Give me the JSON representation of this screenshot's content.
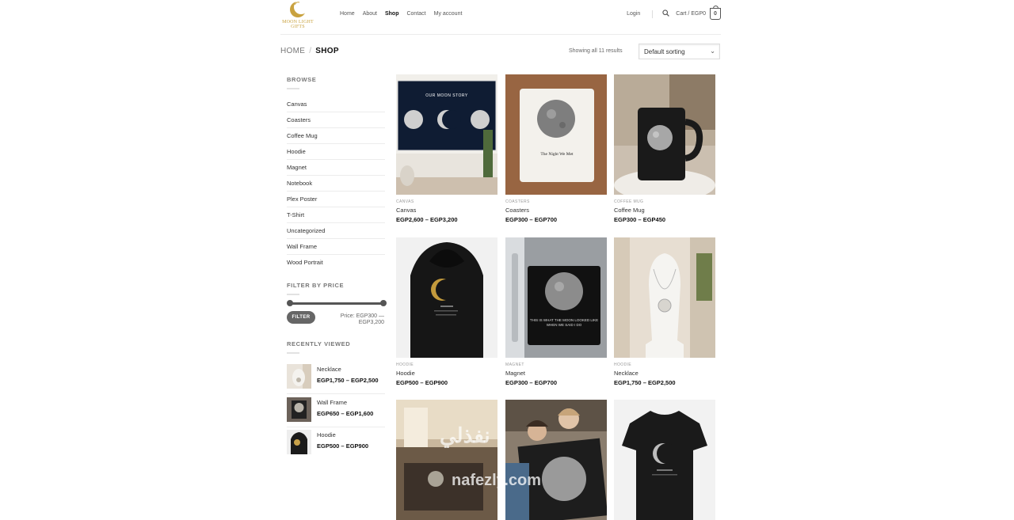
{
  "header": {
    "logo_text": "MOON LIGHT GIFTS",
    "nav": [
      "Home",
      "About",
      "Shop",
      "Contact",
      "My account"
    ],
    "active_nav": "Shop",
    "login": "Login",
    "cart_label": "Cart / EGP0",
    "cart_count": "0"
  },
  "breadcrumb": {
    "home": "HOME",
    "separator": "/",
    "current": "SHOP"
  },
  "results_text": "Showing all 11 results",
  "sort": {
    "selected": "Default sorting"
  },
  "sidebar": {
    "browse_title": "BROWSE",
    "categories": [
      "Canvas",
      "Coasters",
      "Coffee Mug",
      "Hoodie",
      "Magnet",
      "Notebook",
      "Plex Poster",
      "T-Shirt",
      "Uncategorized",
      "Wall Frame",
      "Wood Portrait"
    ],
    "filter_title": "FILTER BY PRICE",
    "filter_button": "FILTER",
    "price_range": "Price: EGP300 — EGP3,200",
    "recent_title": "RECENTLY VIEWED",
    "recent": [
      {
        "name": "Necklace",
        "price": "EGP1,750 – EGP2,500"
      },
      {
        "name": "Wall Frame",
        "price": "EGP650 – EGP1,600"
      },
      {
        "name": "Hoodie",
        "price": "EGP500 – EGP900"
      }
    ]
  },
  "products": [
    {
      "category": "CANVAS",
      "name": "Canvas",
      "price": "EGP2,600 – EGP3,200",
      "image_text": "OUR MOON STORY"
    },
    {
      "category": "COASTERS",
      "name": "Coasters",
      "price": "EGP300 – EGP700",
      "image_text": "The Night We Met"
    },
    {
      "category": "COFFEE MUG",
      "name": "Coffee Mug",
      "price": "EGP300 – EGP450"
    },
    {
      "category": "HOODIE",
      "name": "Hoodie",
      "price": "EGP500 – EGP900"
    },
    {
      "category": "MAGNET",
      "name": "Magnet",
      "price": "EGP300 – EGP700",
      "image_text": "THIS IS WHAT THE MOON LOOKED LIKE WHEN WE SAID I DO"
    },
    {
      "category": "HOODIE",
      "name": "Necklace",
      "price": "EGP1,750 – EGP2,500"
    },
    {
      "category": "",
      "name": "",
      "price": ""
    },
    {
      "category": "",
      "name": "",
      "price": ""
    },
    {
      "category": "",
      "name": "",
      "price": ""
    }
  ],
  "watermark": {
    "arabic": "نفذلي",
    "latin": "nafezly.com"
  },
  "colors": {
    "gold": "#c9a23f",
    "dark": "#111111",
    "button": "#666666"
  }
}
